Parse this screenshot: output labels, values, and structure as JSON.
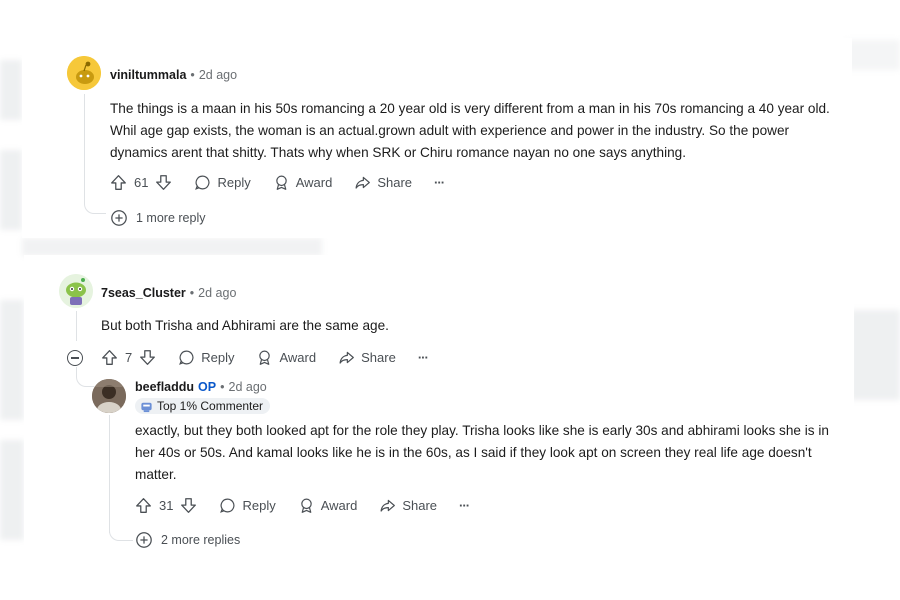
{
  "comments": [
    {
      "author": "viniltummala",
      "time": "2d ago",
      "body": "The things is a maan in his 50s romancing a 20 year old is very different from a man in his 70s romancing a 40 year old. Whil age gap exists, the woman is an actual.grown adult with experience and power in the industry. So the power dynamics arent that shitty. Thats why when SRK or Chiru romance nayan no one says anything.",
      "votes": "61",
      "more_replies": "1 more reply"
    },
    {
      "author": "7seas_Cluster",
      "time": "2d ago",
      "body": "But both Trisha and Abhirami are the same age.",
      "votes": "7"
    },
    {
      "author": "beefladdu",
      "op_label": "OP",
      "time": "2d ago",
      "badge": "Top 1% Commenter",
      "body": "exactly, but they both looked apt for the role they play. Trisha looks like she is early 30s and abhirami looks she is in her 40s or 50s. And kamal looks like he is in the 60s, as I said if they look apt on screen they real life age doesn't matter.",
      "votes": "31",
      "more_replies": "2 more replies"
    }
  ],
  "actions": {
    "reply": "Reply",
    "award": "Award",
    "share": "Share",
    "more": "···"
  },
  "separator": "•",
  "colors": {
    "op": "#0a58ca",
    "meta": "#6b6f73",
    "thread": "#dfe2e5"
  }
}
